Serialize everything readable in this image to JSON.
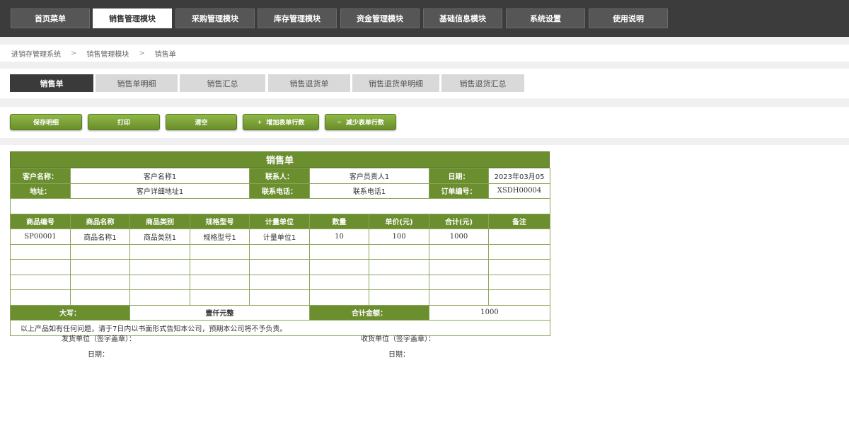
{
  "topnav": {
    "items": [
      "首页菜单",
      "销售管理模块",
      "采购管理模块",
      "库存管理模块",
      "资金管理模块",
      "基础信息模块",
      "系统设置",
      "使用说明"
    ],
    "active_index": 1
  },
  "breadcrumb": [
    "进销存管理系统",
    "销售管理模块",
    "销售单"
  ],
  "breadcrumb_separator": ">",
  "subtabs": {
    "items": [
      "销售单",
      "销售单明细",
      "销售汇总",
      "销售退货单",
      "销售退货单明细",
      "销售退货汇总"
    ],
    "active_index": 0
  },
  "toolbar": {
    "save_label": "保存明细",
    "print_label": "打印",
    "clear_label": "清空",
    "add_rows_label": "增加表单行数",
    "remove_rows_label": "减少表单行数",
    "add_glyph": "+",
    "remove_glyph": "−"
  },
  "form": {
    "title": "销售单",
    "customer_name_label": "客户名称：",
    "customer_name": "客户名称1",
    "contact_label": "联系人：",
    "contact": "客户员责人1",
    "date_label": "日期：",
    "date": "2023年03月05",
    "address_label": "地址：",
    "address": "客户详细地址1",
    "phone_label": "联系电话：",
    "phone": "联系电话1",
    "order_no_label": "订单编号：",
    "order_no": "XSDH00004",
    "columns": [
      "商品编号",
      "商品名称",
      "商品类别",
      "规格型号",
      "计量单位",
      "数量",
      "单价(元)",
      "合计(元)",
      "备注"
    ],
    "rows": [
      [
        "SP00001",
        "商品名称1",
        "商品类别1",
        "规格型号1",
        "计量单位1",
        "10",
        "100",
        "1000",
        ""
      ],
      [
        "",
        "",
        "",
        "",
        "",
        "",
        "",
        "",
        ""
      ],
      [
        "",
        "",
        "",
        "",
        "",
        "",
        "",
        "",
        ""
      ],
      [
        "",
        "",
        "",
        "",
        "",
        "",
        "",
        "",
        ""
      ],
      [
        "",
        "",
        "",
        "",
        "",
        "",
        "",
        "",
        ""
      ]
    ],
    "capital_label": "大写：",
    "capital_value": "壹仟元整",
    "total_label": "合计金额：",
    "total_value": "1000",
    "notice": "以上产品如有任何问题，请于7日内以书面形式告知本公司，预期本公司将不予负责。",
    "sender_label": "发货单位（签字盖章）：",
    "sender_date_label": "日期：",
    "receiver_label": "收货单位（签字盖章）：",
    "receiver_date_label": "日期："
  },
  "colors": {
    "accent_green": "#6b8e2f",
    "nav_dark": "#3c3c3c"
  }
}
